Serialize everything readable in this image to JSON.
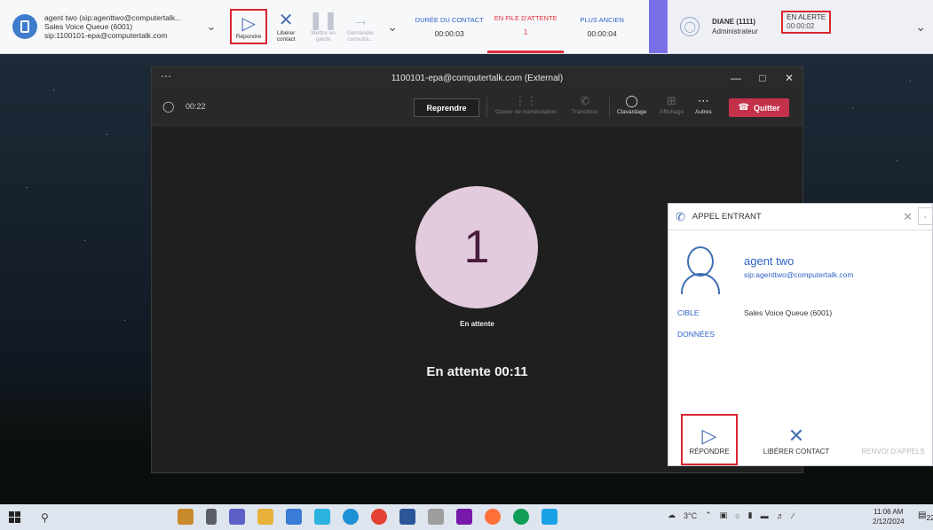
{
  "topbar": {
    "contact": {
      "line1": "agent two (sip:agenttwo@computertalk...",
      "line2": "Sales Voice Queue (6001)",
      "line3": "sip:1100101-epa@computertalk.com"
    },
    "actions": [
      {
        "label": "Répondre",
        "icon": "play-outline-icon"
      },
      {
        "label": "Libérer contact",
        "icon": "x-icon"
      },
      {
        "label": "Mettre en garde",
        "icon": "pause-icon"
      },
      {
        "label": "Demander consulta...",
        "icon": "arrow-right-icon"
      }
    ],
    "stats": [
      {
        "label": "DURÉE DU CONTACT",
        "value": "00:00:03"
      },
      {
        "label": "EN FILE D'ATTENTE",
        "value": "1"
      },
      {
        "label": "PLUS ANCIEN",
        "value": "00:00:04"
      }
    ],
    "agent": {
      "name": "DIANE (1111)",
      "role": "Administrateur",
      "status": "EN ALERTE",
      "status_time": "00:00:02"
    }
  },
  "teams": {
    "title": "1100101-epa@computertalk.com (External)",
    "timer": "00:22",
    "resume": "Reprendre",
    "tools": [
      {
        "label": "Clavier de numérotation",
        "icon": "dialpad-icon"
      },
      {
        "label": "Transférer",
        "icon": "transfer-icon"
      },
      {
        "label": "Clavardage",
        "icon": "chat-icon"
      },
      {
        "label": "Affichage",
        "icon": "layout-icon"
      },
      {
        "label": "Autres",
        "icon": "more-icon"
      }
    ],
    "quit": "Quitter",
    "avatar_text": "1",
    "hold_small": "En attente",
    "hold_big": "En attente 00:11"
  },
  "popup": {
    "title": "APPEL ENTRANT",
    "name": "agent two",
    "sip": "sip:agenttwo@computertalk.com",
    "cible_label": "CIBLE",
    "cible_value": "Sales Voice Queue (6001)",
    "data_label": "DONNÉES",
    "buttons": {
      "answer": "RÉPONDRE",
      "release": "LIBÉRER CONTACT",
      "forward": "RENVOI D'APPELS"
    }
  },
  "taskbar": {
    "weather": "3°C",
    "time": "11:06 AM",
    "date": "2/12/2024",
    "notif_count": "22"
  },
  "colors": {
    "accent_blue": "#2f62c4",
    "alert_red": "#d9262f",
    "teams_quit": "#c4314b",
    "avatar_bg": "#e2cbdd"
  }
}
